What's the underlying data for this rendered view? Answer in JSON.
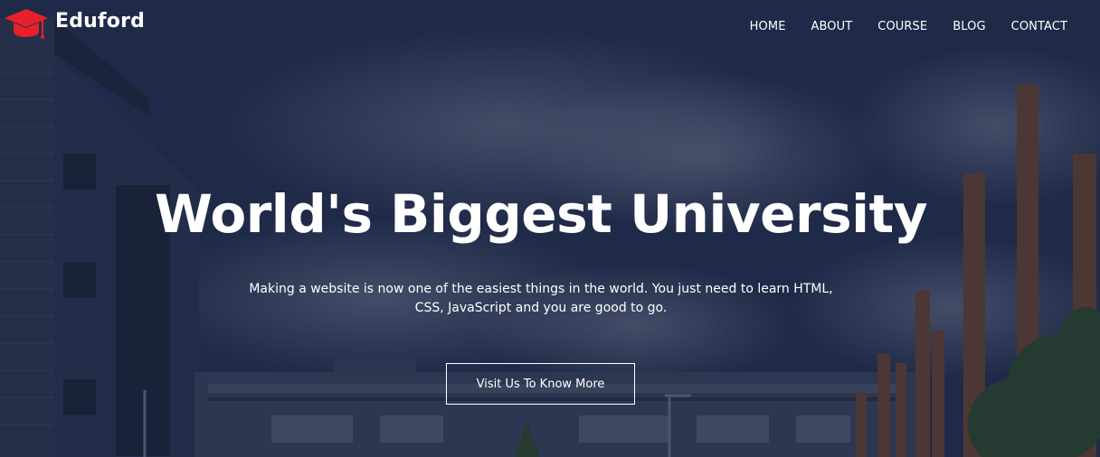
{
  "brand": {
    "name": "Eduford",
    "icon": "graduation-cap-icon",
    "accent_color": "#e8202a"
  },
  "nav": {
    "items": [
      "HOME",
      "ABOUT",
      "COURSE",
      "BLOG",
      "CONTACT"
    ]
  },
  "hero": {
    "headline": "World's Biggest University",
    "subtext": "Making a website is now one of the easiest things in the world. You just need to learn HTML, CSS, JavaScript and you are good to go.",
    "cta_label": "Visit Us To Know More"
  }
}
